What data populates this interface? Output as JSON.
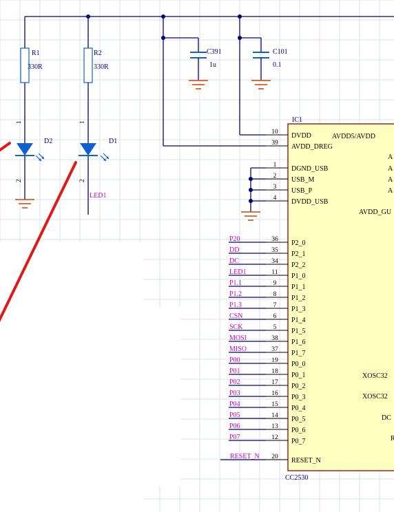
{
  "colors": {
    "wire": "#000080",
    "net_label": "#c800c8",
    "chip_fill": "#ffffc0",
    "chip_border": "#a02020",
    "component": "#1060d0",
    "ground": "#d04000",
    "marker": "#e01818",
    "grid": "#dde3ea"
  },
  "resistors": [
    {
      "ref": "R1",
      "value": "330R"
    },
    {
      "ref": "R2",
      "value": "330R"
    }
  ],
  "capacitors": [
    {
      "ref": "C391",
      "value": "1u"
    },
    {
      "ref": "C101",
      "value": "0.1"
    }
  ],
  "leds": [
    {
      "ref": "D2",
      "pin_top": "1",
      "pin_bottom": "2"
    },
    {
      "ref": "D1",
      "pin_top": "1",
      "pin_bottom": "2",
      "net": "LED1"
    }
  ],
  "ic": {
    "ref": "IC1",
    "part": "CC2530",
    "left_pins": [
      {
        "num": "10",
        "name": "DVDD"
      },
      {
        "num": "39",
        "name": "AVDD_DREG"
      },
      {
        "num": "1",
        "name": "DGND_USB"
      },
      {
        "num": "2",
        "name": "USB_M"
      },
      {
        "num": "3",
        "name": "USB_P"
      },
      {
        "num": "4",
        "name": "DVDD_USB"
      },
      {
        "num": "36",
        "name": "P2_0",
        "net": "P20"
      },
      {
        "num": "35",
        "name": "P2_1",
        "net": "DD"
      },
      {
        "num": "34",
        "name": "P2_2",
        "net": "DC"
      },
      {
        "num": "11",
        "name": "P1_0",
        "net": "LED1"
      },
      {
        "num": "9",
        "name": "P1_1",
        "net": "P1.1"
      },
      {
        "num": "8",
        "name": "P1_2",
        "net": "P1.2"
      },
      {
        "num": "7",
        "name": "P1_3",
        "net": "P1.3"
      },
      {
        "num": "6",
        "name": "P1_4",
        "net": "CSN"
      },
      {
        "num": "5",
        "name": "P1_5",
        "net": "SCK"
      },
      {
        "num": "38",
        "name": "P1_6",
        "net": "MOSI"
      },
      {
        "num": "37",
        "name": "P1_7",
        "net": "MISO"
      },
      {
        "num": "19",
        "name": "P0_0",
        "net": "P00"
      },
      {
        "num": "18",
        "name": "P0_1",
        "net": "P01"
      },
      {
        "num": "17",
        "name": "P0_2",
        "net": "P02"
      },
      {
        "num": "16",
        "name": "P0_3",
        "net": "P03"
      },
      {
        "num": "15",
        "name": "P0_4",
        "net": "P04"
      },
      {
        "num": "14",
        "name": "P0_5",
        "net": "P05"
      },
      {
        "num": "13",
        "name": "P0_6",
        "net": "P06"
      },
      {
        "num": "12",
        "name": "P0_7",
        "net": "P07"
      },
      {
        "num": "20",
        "name": "RESET_N",
        "net": "RESET_N"
      }
    ],
    "right_labels": [
      {
        "name": "AVDD5/AVDD"
      },
      {
        "name": "A"
      },
      {
        "name": "A"
      },
      {
        "name": "A"
      },
      {
        "name": "A"
      },
      {
        "name": "AVDD_GU"
      },
      {
        "name": "XOSC32"
      },
      {
        "name": "XOSC32"
      },
      {
        "name": "DC"
      },
      {
        "name": "R"
      }
    ]
  }
}
